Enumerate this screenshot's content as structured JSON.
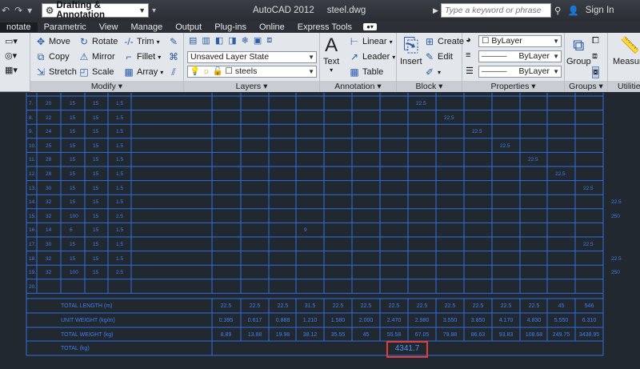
{
  "titlebar": {
    "workspace": "Drafting & Annotation",
    "app_name": "AutoCAD 2012",
    "file_name": "steel.dwg",
    "search_placeholder": "Type a keyword or phrase",
    "sign_in": "Sign In"
  },
  "menu": [
    "notate",
    "Parametric",
    "View",
    "Manage",
    "Output",
    "Plug-ins",
    "Online",
    "Express Tools"
  ],
  "ribbon": {
    "modify": {
      "title": "Modify",
      "move": "Move",
      "rotate": "Rotate",
      "trim": "Trim",
      "copy": "Copy",
      "mirror": "Mirror",
      "fillet": "Fillet",
      "stretch": "Stretch",
      "scale": "Scale",
      "array": "Array"
    },
    "layers": {
      "title": "Layers",
      "layer_state": "Unsaved Layer State",
      "current_layer": "steels"
    },
    "annotation": {
      "title": "Annotation",
      "text": "Text",
      "linear": "Linear",
      "leader": "Leader",
      "table": "Table"
    },
    "block": {
      "title": "Block",
      "insert": "Insert",
      "create": "Create",
      "edit": "Edit"
    },
    "properties": {
      "title": "Properties",
      "color": "ByLayer",
      "linetype": "ByLayer",
      "lineweight": "ByLayer"
    },
    "groups": {
      "title": "Groups",
      "group": "Group"
    },
    "utilities": {
      "title": "Utilities",
      "measure": "Measure"
    }
  },
  "table": {
    "rows": [
      {
        "no": "7.",
        "a": "20",
        "b": "15",
        "c": "15",
        "d": "1.5",
        "mark_col": 7,
        "mark": "22.5"
      },
      {
        "no": "8.",
        "a": "22",
        "b": "15",
        "c": "15",
        "d": "1.5",
        "mark_col": 8,
        "mark": "22.5"
      },
      {
        "no": "9.",
        "a": "24",
        "b": "15",
        "c": "15",
        "d": "1.5",
        "mark_col": 9,
        "mark": "22.5"
      },
      {
        "no": "10.",
        "a": "25",
        "b": "15",
        "c": "15",
        "d": "1.5",
        "mark_col": 10,
        "mark": "22.5"
      },
      {
        "no": "11.",
        "a": "28",
        "b": "15",
        "c": "15",
        "d": "1.5",
        "mark_col": 11,
        "mark": "22.5"
      },
      {
        "no": "12.",
        "a": "28",
        "b": "15",
        "c": "15",
        "d": "1.5",
        "mark_col": 12,
        "mark": "22.5"
      },
      {
        "no": "13.",
        "a": "30",
        "b": "15",
        "c": "15",
        "d": "1.5",
        "mark_col": 13,
        "mark": "22.5"
      },
      {
        "no": "14.",
        "a": "32",
        "b": "15",
        "c": "15",
        "d": "1.5",
        "mark_col": 14,
        "mark": "22.5"
      },
      {
        "no": "15.",
        "a": "32",
        "b": "100",
        "c": "15",
        "d": "2.5",
        "mark_col": 14,
        "mark": "250"
      },
      {
        "no": "16.",
        "a": "14",
        "b": "6",
        "c": "15",
        "d": "1.5",
        "mark_col": 3,
        "mark": "9"
      },
      {
        "no": "17.",
        "a": "30",
        "b": "15",
        "c": "15",
        "d": "1.5",
        "mark_col": 13,
        "mark": "22.5"
      },
      {
        "no": "18.",
        "a": "32",
        "b": "15",
        "c": "15",
        "d": "1.5",
        "mark_col": 14,
        "mark": "22.5"
      },
      {
        "no": "19.",
        "a": "32",
        "b": "100",
        "c": "15",
        "d": "2.5",
        "mark_col": 14,
        "mark": "250"
      },
      {
        "no": "20.",
        "a": "",
        "b": "",
        "c": "",
        "d": "",
        "mark_col": -1,
        "mark": ""
      }
    ],
    "total_length_label": "TOTAL LENGTH   (m)",
    "total_length": [
      "22.5",
      "22.5",
      "22.5",
      "31.5",
      "22.5",
      "22.5",
      "22.5",
      "22.5",
      "22.5",
      "22.5",
      "22.5",
      "22.5",
      "45",
      "546"
    ],
    "unit_weight_label": "UNIT  WEIGHT (kg/m)",
    "unit_weight": [
      "0.395",
      "0.617",
      "0.888",
      "1.210",
      "1.580",
      "2.000",
      "2.470",
      "2.980",
      "3.550",
      "3.850",
      "4.170",
      "4.830",
      "5.550",
      "6.310"
    ],
    "total_weight_label": "TOTAL  WEIGHT (kg)",
    "total_weight": [
      "8.89",
      "13.88",
      "19.98",
      "38.12",
      "35.55",
      "45",
      "55.58",
      "67.05",
      "79.88",
      "86.63",
      "93.83",
      "108.68",
      "249.75",
      "3438.95"
    ],
    "total_label": "TOTAL  (kg)",
    "grand_total": "4341.7"
  }
}
